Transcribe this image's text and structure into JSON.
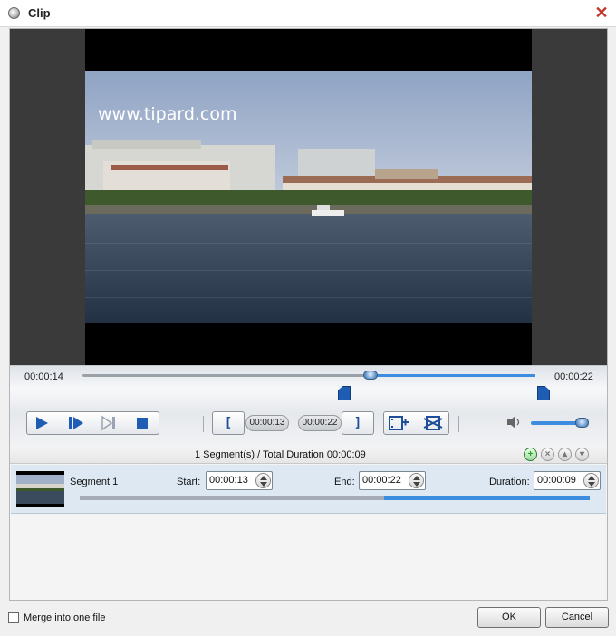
{
  "window": {
    "title": "Clip",
    "close_label": "✕"
  },
  "video": {
    "watermark": "www.tipard.com"
  },
  "playback": {
    "current_time": "00:00:14",
    "end_time": "00:00:22",
    "position_fraction": 0.636,
    "selection_start_fraction": 0.636,
    "selection_end_fraction": 1.0,
    "volume_fraction": 0.9
  },
  "trim": {
    "start_bracket": "[",
    "start_time": "00:00:13",
    "end_time": "00:00:22",
    "end_bracket": "]"
  },
  "summary": {
    "text": "1 Segment(s) / Total Duration 00:00:09"
  },
  "segments": [
    {
      "name": "Segment 1",
      "start_label": "Start:",
      "start": "00:00:13",
      "end_label": "End:",
      "end": "00:00:22",
      "duration_label": "Duration:",
      "duration": "00:00:09",
      "selection_start_fraction": 0.596,
      "selection_end_fraction": 1.0
    }
  ],
  "footer": {
    "merge_label": "Merge into one file",
    "merge_checked": false,
    "ok_label": "OK",
    "cancel_label": "Cancel"
  },
  "colors": {
    "accent": "#3c8de0",
    "close": "#c0392b",
    "marker": "#1e5db3",
    "add_button": "#2e9e2e"
  }
}
